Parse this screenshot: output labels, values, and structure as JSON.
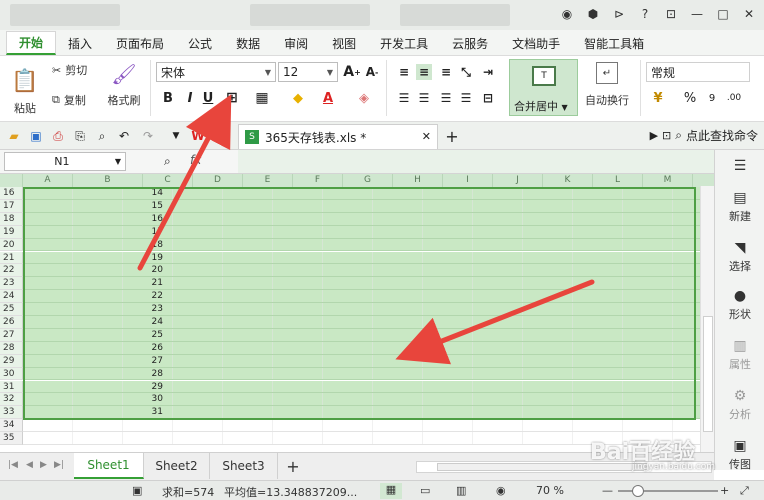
{
  "ribbon_tabs": [
    "开始",
    "插入",
    "页面布局",
    "公式",
    "数据",
    "审阅",
    "视图",
    "开发工具",
    "云服务",
    "文档助手",
    "智能工具箱"
  ],
  "ribbon": {
    "paste": "粘贴",
    "cut": "剪切",
    "copy": "复制",
    "format_painter": "格式刷",
    "font_name": "宋体",
    "font_size": "12",
    "bold": "B",
    "italic": "I",
    "underline": "U",
    "merge_center": "合并居中",
    "wrap_text": "自动换行",
    "number_format": "常规",
    "percent": "%",
    "comma": "9"
  },
  "document_tab": {
    "name": "365天存钱表.xls *"
  },
  "search": {
    "label": "点此查找命令"
  },
  "name_box": {
    "value": "N1"
  },
  "columns": [
    "A",
    "B",
    "C",
    "D",
    "E",
    "F",
    "G",
    "H",
    "I",
    "J",
    "K",
    "L",
    "M"
  ],
  "rows": [
    {
      "num": "16",
      "b": "14"
    },
    {
      "num": "17",
      "b": "15"
    },
    {
      "num": "18",
      "b": "16"
    },
    {
      "num": "19",
      "b": "17"
    },
    {
      "num": "20",
      "b": "18"
    },
    {
      "num": "21",
      "b": "19"
    },
    {
      "num": "22",
      "b": "20"
    },
    {
      "num": "23",
      "b": "21"
    },
    {
      "num": "24",
      "b": "22"
    },
    {
      "num": "25",
      "b": "23"
    },
    {
      "num": "26",
      "b": "24"
    },
    {
      "num": "27",
      "b": "25"
    },
    {
      "num": "28",
      "b": "26"
    },
    {
      "num": "29",
      "b": "27"
    },
    {
      "num": "30",
      "b": "28"
    },
    {
      "num": "31",
      "b": "29"
    },
    {
      "num": "32",
      "b": "30"
    },
    {
      "num": "33",
      "b": "31"
    },
    {
      "num": "34",
      "b": ""
    },
    {
      "num": "35",
      "b": ""
    }
  ],
  "side_panel": [
    "新建",
    "选择",
    "形状",
    "属性",
    "分析",
    "传图"
  ],
  "sheets": [
    "Sheet1",
    "Sheet2",
    "Sheet3"
  ],
  "status": {
    "sum": "求和=574",
    "average": "平均值=13.348837209...",
    "zoom": "70 %"
  },
  "watermark": {
    "brand": "Bai百经验",
    "url": "jingyan.baidu.com"
  },
  "colors": {
    "accent": "#35a035",
    "selection": "#c9e8c4",
    "arrow": "#e8453c"
  }
}
